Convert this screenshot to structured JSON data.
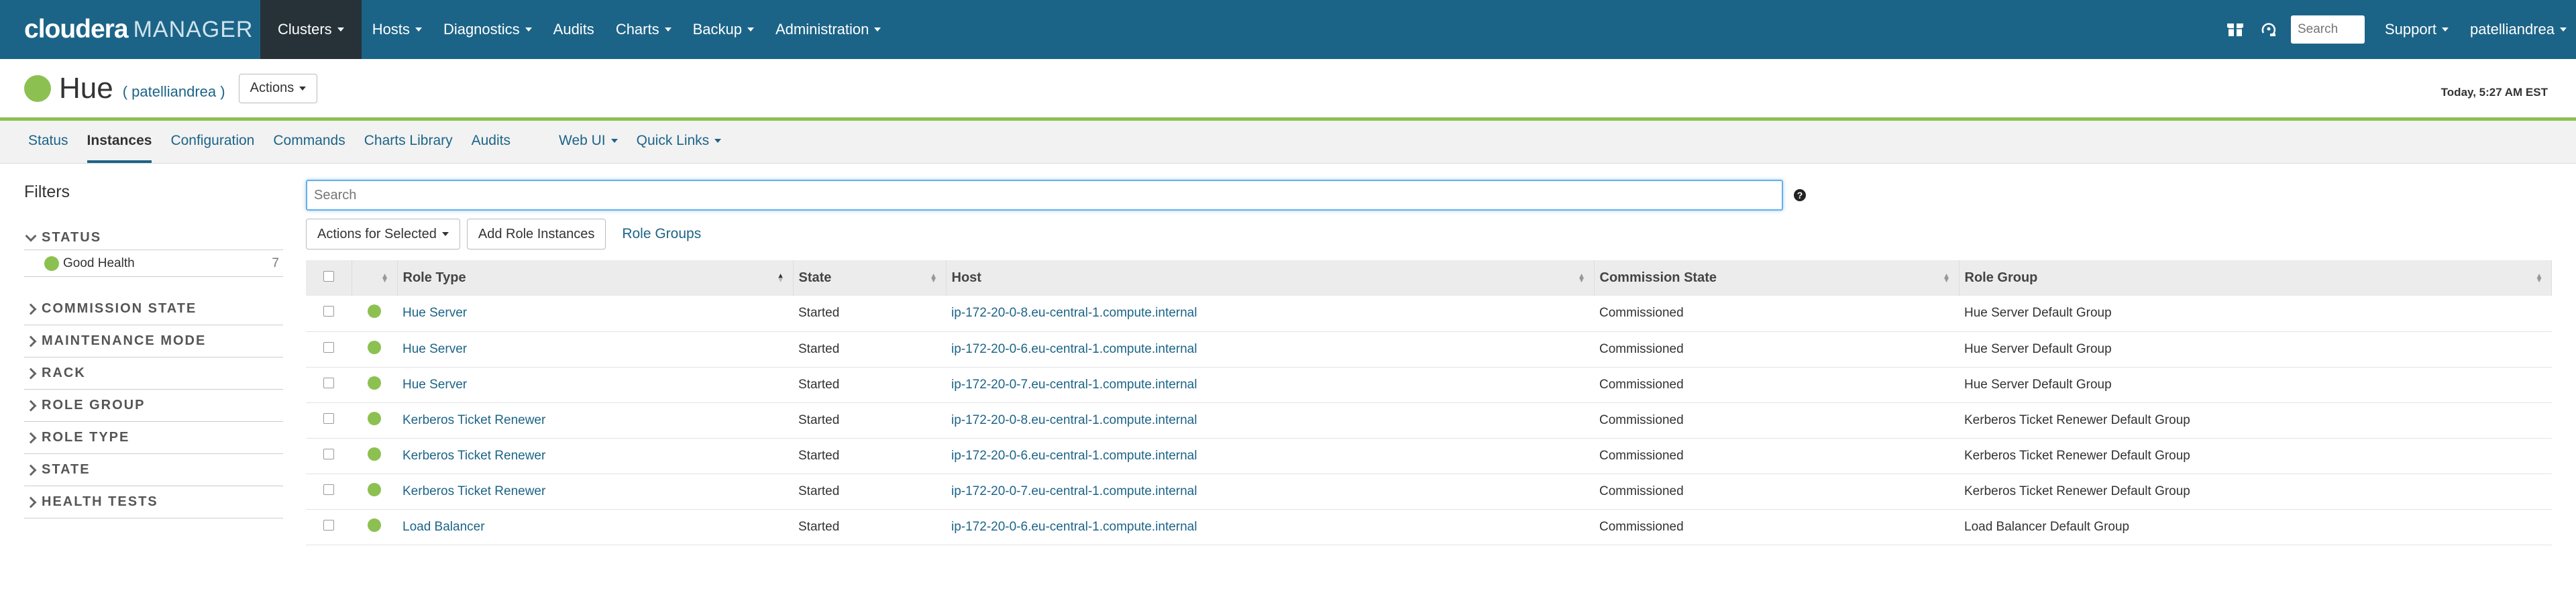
{
  "topnav": {
    "brand_main": "cloudera",
    "brand_sub": "MANAGER",
    "items": [
      {
        "label": "Clusters",
        "dropdown": true,
        "active": true
      },
      {
        "label": "Hosts",
        "dropdown": true
      },
      {
        "label": "Diagnostics",
        "dropdown": true
      },
      {
        "label": "Audits",
        "dropdown": false
      },
      {
        "label": "Charts",
        "dropdown": true
      },
      {
        "label": "Backup",
        "dropdown": true
      },
      {
        "label": "Administration",
        "dropdown": true
      }
    ],
    "search_placeholder": "Search",
    "support_label": "Support",
    "user_label": "patelliandrea"
  },
  "service": {
    "name": "Hue",
    "cluster": "patelliandrea",
    "actions_label": "Actions",
    "timestamp": "Today, 5:27 AM EST",
    "status_color": "#8cc152"
  },
  "subtabs": [
    {
      "label": "Status"
    },
    {
      "label": "Instances",
      "active": true
    },
    {
      "label": "Configuration"
    },
    {
      "label": "Commands"
    },
    {
      "label": "Charts Library"
    },
    {
      "label": "Audits"
    },
    {
      "label": "Web UI",
      "dropdown": true
    },
    {
      "label": "Quick Links",
      "dropdown": true
    }
  ],
  "filters": {
    "title": "Filters",
    "status_facet": "STATUS",
    "status_values": [
      {
        "label": "Good Health",
        "count": "7"
      }
    ],
    "facets": [
      "COMMISSION STATE",
      "MAINTENANCE MODE",
      "RACK",
      "ROLE GROUP",
      "ROLE TYPE",
      "STATE",
      "HEALTH TESTS"
    ]
  },
  "search": {
    "placeholder": "Search"
  },
  "toolbar": {
    "actions_selected": "Actions for Selected",
    "add_role_instances": "Add Role Instances",
    "role_groups": "Role Groups"
  },
  "table": {
    "headers": {
      "role_type": "Role Type",
      "state": "State",
      "host": "Host",
      "commission_state": "Commission State",
      "role_group": "Role Group"
    },
    "rows": [
      {
        "role_type": "Hue Server",
        "state": "Started",
        "host": "ip-172-20-0-8.eu-central-1.compute.internal",
        "commission_state": "Commissioned",
        "role_group": "Hue Server Default Group"
      },
      {
        "role_type": "Hue Server",
        "state": "Started",
        "host": "ip-172-20-0-6.eu-central-1.compute.internal",
        "commission_state": "Commissioned",
        "role_group": "Hue Server Default Group"
      },
      {
        "role_type": "Hue Server",
        "state": "Started",
        "host": "ip-172-20-0-7.eu-central-1.compute.internal",
        "commission_state": "Commissioned",
        "role_group": "Hue Server Default Group"
      },
      {
        "role_type": "Kerberos Ticket Renewer",
        "state": "Started",
        "host": "ip-172-20-0-8.eu-central-1.compute.internal",
        "commission_state": "Commissioned",
        "role_group": "Kerberos Ticket Renewer Default Group"
      },
      {
        "role_type": "Kerberos Ticket Renewer",
        "state": "Started",
        "host": "ip-172-20-0-6.eu-central-1.compute.internal",
        "commission_state": "Commissioned",
        "role_group": "Kerberos Ticket Renewer Default Group"
      },
      {
        "role_type": "Kerberos Ticket Renewer",
        "state": "Started",
        "host": "ip-172-20-0-7.eu-central-1.compute.internal",
        "commission_state": "Commissioned",
        "role_group": "Kerberos Ticket Renewer Default Group"
      },
      {
        "role_type": "Load Balancer",
        "state": "Started",
        "host": "ip-172-20-0-6.eu-central-1.compute.internal",
        "commission_state": "Commissioned",
        "role_group": "Load Balancer Default Group"
      }
    ]
  }
}
